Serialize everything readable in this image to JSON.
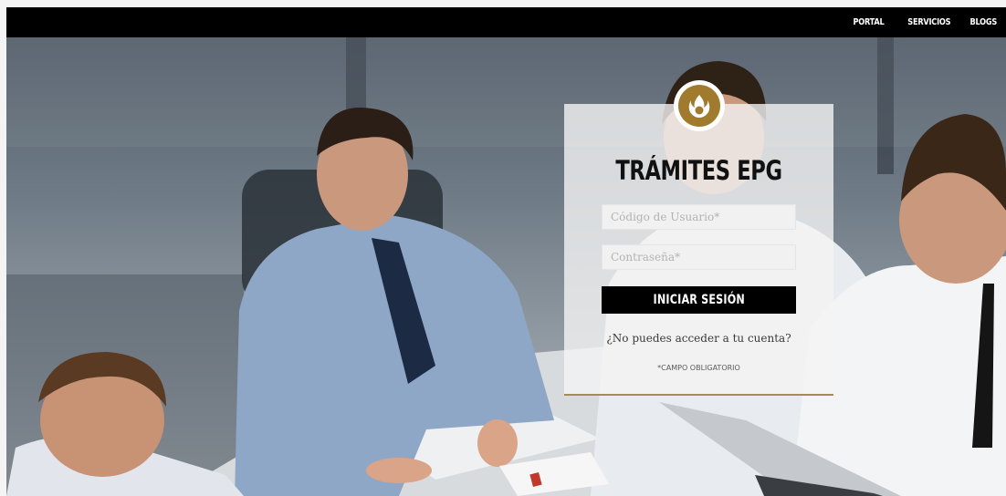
{
  "nav": {
    "items": [
      {
        "label": "PORTAL"
      },
      {
        "label": "SERVICIOS"
      },
      {
        "label": "BLOGS"
      }
    ]
  },
  "login": {
    "title": "TRÁMITES EPG",
    "username_placeholder": "Código de Usuario*",
    "password_placeholder": "Contraseña*",
    "submit_label": "INICIAR SESIÓN",
    "forgot_link": "¿No puedes acceder a tu cuenta?",
    "required_note": "*CAMPO OBLIGATORIO"
  },
  "colors": {
    "topbar": "#000000",
    "brand_gold": "#a07b2e",
    "card_accent": "#a58c52",
    "button": "#000000"
  },
  "icons": {
    "logo": "flame-logo-icon"
  }
}
